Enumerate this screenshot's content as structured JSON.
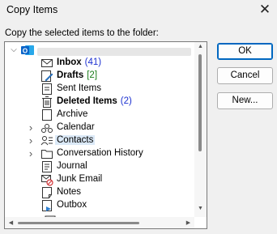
{
  "window": {
    "title": "Copy Items"
  },
  "prompt": "Copy the selected items to the folder:",
  "buttons": {
    "ok": "OK",
    "cancel": "Cancel",
    "new": "New..."
  },
  "tree": {
    "root": {
      "icon": "outlook-account-icon",
      "expanded": true
    },
    "items": [
      {
        "label": "Inbox",
        "count": "(41)",
        "count_color": "#1c30d0",
        "bold": true,
        "icon": "inbox-icon",
        "expandable": false
      },
      {
        "label": "Drafts",
        "count": "[2]",
        "count_color": "#1a7d1a",
        "bold": true,
        "icon": "drafts-icon",
        "expandable": false
      },
      {
        "label": "Sent Items",
        "count": "",
        "bold": false,
        "icon": "sent-items-icon",
        "expandable": false
      },
      {
        "label": "Deleted Items",
        "count": "(2)",
        "count_color": "#1c30d0",
        "bold": true,
        "icon": "deleted-items-icon",
        "expandable": false
      },
      {
        "label": "Archive",
        "count": "",
        "bold": false,
        "icon": "archive-icon",
        "expandable": false
      },
      {
        "label": "Calendar",
        "count": "",
        "bold": false,
        "icon": "calendar-icon",
        "expandable": true
      },
      {
        "label": "Contacts",
        "count": "",
        "bold": false,
        "icon": "contacts-icon",
        "expandable": true,
        "selected": true
      },
      {
        "label": "Conversation History",
        "count": "",
        "bold": false,
        "icon": "folder-icon",
        "expandable": true
      },
      {
        "label": "Journal",
        "count": "",
        "bold": false,
        "icon": "journal-icon",
        "expandable": false
      },
      {
        "label": "Junk Email",
        "count": "",
        "bold": false,
        "icon": "junk-email-icon",
        "expandable": false
      },
      {
        "label": "Notes",
        "count": "",
        "bold": false,
        "icon": "notes-icon",
        "expandable": false
      },
      {
        "label": "Outbox",
        "count": "",
        "bold": false,
        "icon": "outbox-icon",
        "expandable": false
      }
    ]
  },
  "colors": {
    "accent": "#0067c0",
    "selection": "#dbe9f7",
    "outlook_blue": "#0a64c8"
  }
}
